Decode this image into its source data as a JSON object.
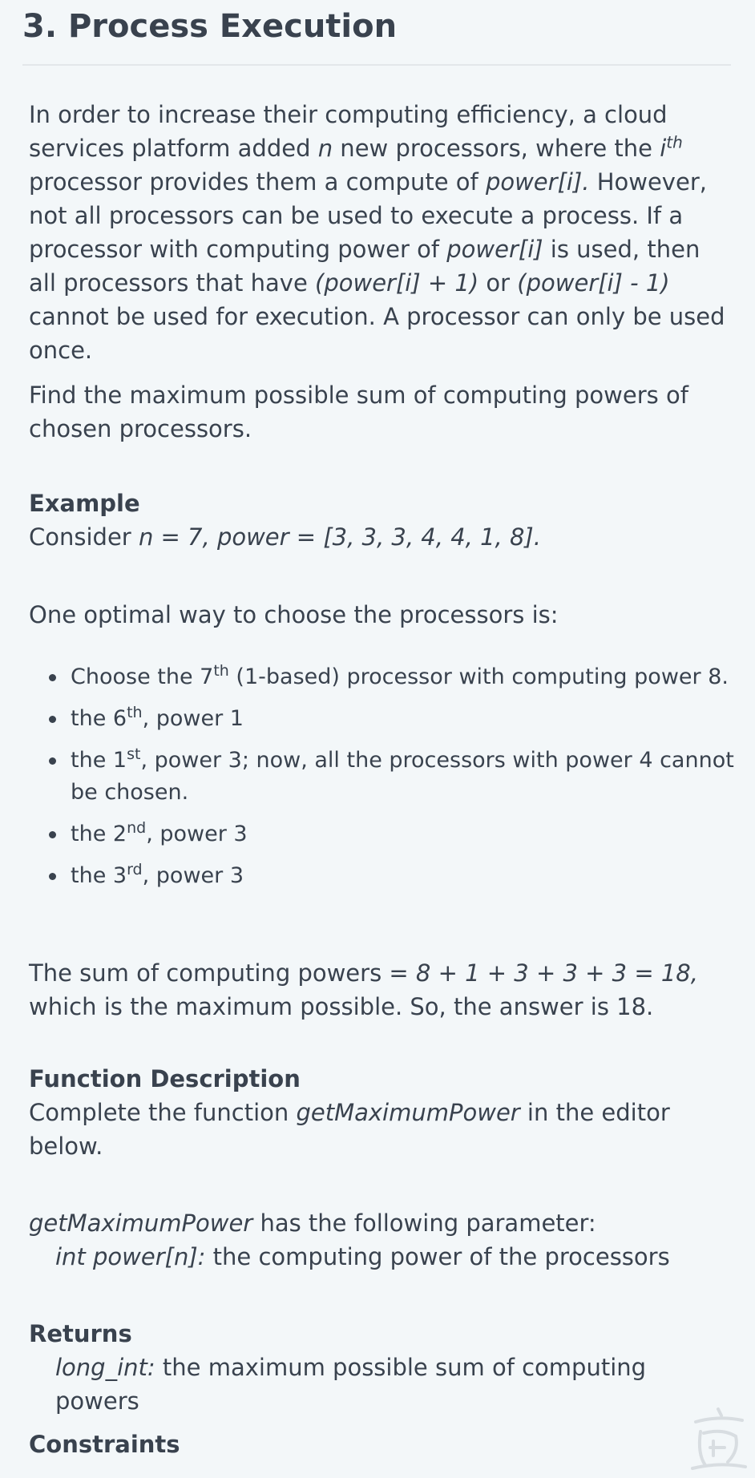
{
  "title": "3. Process Execution",
  "intro": {
    "s1": "In order to increase their computing efficiency, a cloud services platform added ",
    "n": "n",
    "s2": " new processors, where the ",
    "i": "i",
    "th": "th",
    "s3": " processor provides them a compute of ",
    "power_i": "power[i].",
    "s4": " However, not all processors can be used to execute a process. If a processor with computing power of ",
    "power_i2": "power[i]",
    "s5": " is used, then all processors that have ",
    "plus": "(power[i] + 1)",
    "or": " or ",
    "minus": "(power[i] - 1)",
    "s6": " cannot be used for execution. A processor can only be used once."
  },
  "task": "Find the maximum possible sum of computing powers of chosen processors.",
  "example": {
    "heading": "Example",
    "consider": "Consider ",
    "expr": "n = 7, power",
    "eq": " = ",
    "array": "[3, 3, 3, 4, 4, 1, 8].",
    "optimal": "One optimal way to choose the processors is:"
  },
  "steps": [
    {
      "pre": "Choose the 7",
      "sup": "th",
      "post": " (1-based) processor with computing power 8."
    },
    {
      "pre": "the 6",
      "sup": "th",
      "post": ", power 1"
    },
    {
      "pre": "the 1",
      "sup": "st",
      "post": ", power 3; now, all the processors with power 4 cannot be chosen."
    },
    {
      "pre": "the 2",
      "sup": "nd",
      "post": ", power 3"
    },
    {
      "pre": "the 3",
      "sup": "rd",
      "post": ", power 3"
    }
  ],
  "sum": {
    "pre": "The sum of computing powers = ",
    "expr": "8 + 1 + 3 + 3 + 3 = 18,",
    "post": " which is the maximum possible. So, the answer is 18."
  },
  "function": {
    "heading": "Function Description",
    "pre": "Complete the function ",
    "name": "getMaximumPower",
    "post": " in the editor below.",
    "name2": "getMaximumPower",
    "has_param": " has the following parameter:",
    "param_type": "int power[n]:",
    "param_desc": " the computing power of the processors"
  },
  "returns": {
    "heading": "Returns",
    "type": "long_int:",
    "desc": " the maximum possible sum of computing powers"
  },
  "constraints": {
    "heading": "Constraints"
  }
}
